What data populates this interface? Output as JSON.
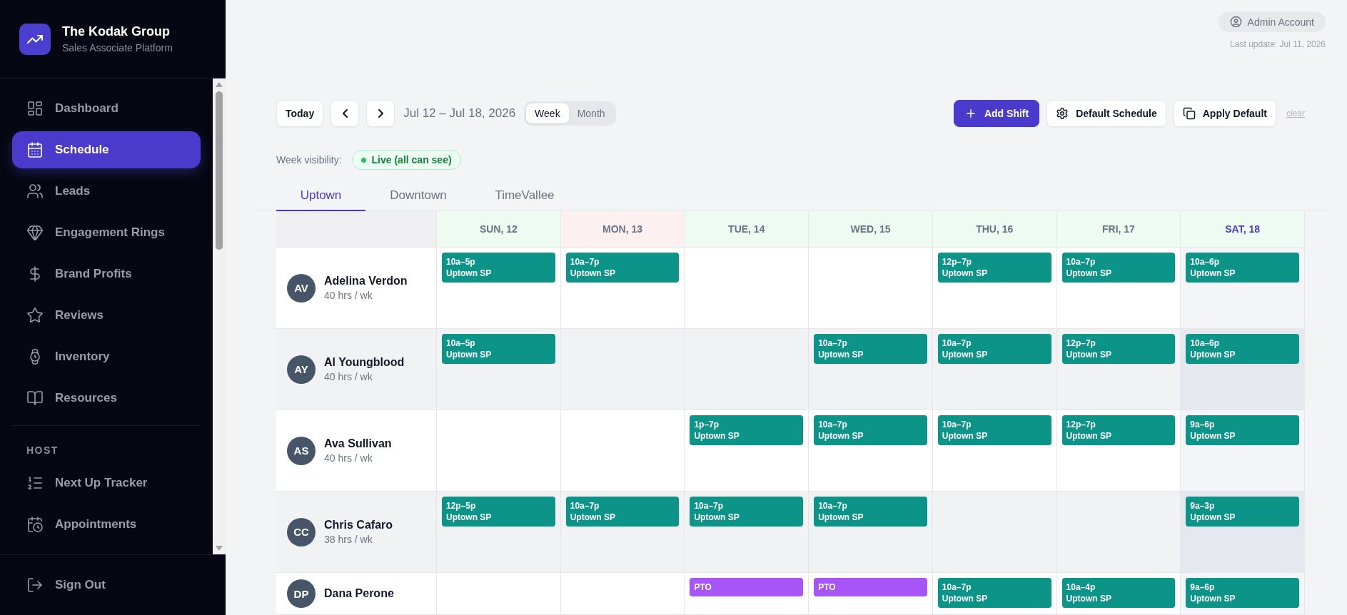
{
  "brand": {
    "title": "The Kodak Group",
    "subtitle": "Sales Associate Platform"
  },
  "sidebar": {
    "items": [
      {
        "label": "Dashboard",
        "selected": false
      },
      {
        "label": "Schedule",
        "selected": true
      },
      {
        "label": "Leads",
        "selected": false
      },
      {
        "label": "Engagement Rings",
        "selected": false
      },
      {
        "label": "Brand Profits",
        "selected": false
      },
      {
        "label": "Reviews",
        "selected": false
      },
      {
        "label": "Inventory",
        "selected": false
      },
      {
        "label": "Resources",
        "selected": false
      }
    ],
    "section": "HOST",
    "host_items": [
      {
        "label": "Next Up Tracker",
        "selected": false
      },
      {
        "label": "Appointments",
        "selected": false
      }
    ],
    "sign_out": "Sign Out"
  },
  "header": {
    "account": "Admin Account",
    "last_update": "Last update: Jul 11, 2026"
  },
  "toolbar": {
    "today": "Today",
    "range": "Jul 12 – Jul 18, 2026",
    "views": [
      {
        "label": "Week",
        "selected": true
      },
      {
        "label": "Month",
        "selected": false
      }
    ],
    "add_shift": "Add Shift",
    "default_schedule": "Default Schedule",
    "apply_default": "Apply Default",
    "clear": "clear"
  },
  "visibility": {
    "label": "Week visibility:",
    "status": "Live (all can see)"
  },
  "location_tabs": [
    {
      "label": "Uptown",
      "selected": true
    },
    {
      "label": "Downtown",
      "selected": false
    },
    {
      "label": "TimeVallee",
      "selected": false
    }
  ],
  "schedule": {
    "days": [
      {
        "label": "SUN, 12",
        "color": "#edfbf2",
        "selected": false
      },
      {
        "label": "MON, 13",
        "color": "#fdf0f0",
        "selected": false
      },
      {
        "label": "TUE, 14",
        "color": "#edfbf2",
        "selected": false
      },
      {
        "label": "WED, 15",
        "color": "#edfbf2",
        "selected": false
      },
      {
        "label": "THU, 16",
        "color": "#edfbf2",
        "selected": false
      },
      {
        "label": "FRI, 17",
        "color": "#edfbf2",
        "selected": false
      },
      {
        "label": "SAT, 18",
        "color": "#edfbf2",
        "selected": true
      }
    ],
    "rows": [
      {
        "initials": "AV",
        "name": "Adelina Verdon",
        "hours": "40 hrs / wk",
        "cells": [
          {
            "kind": "shift",
            "time": "10a–5p",
            "location": "Uptown SP"
          },
          {
            "kind": "shift",
            "time": "10a–7p",
            "location": "Uptown SP"
          },
          null,
          null,
          {
            "kind": "shift",
            "time": "12p–7p",
            "location": "Uptown SP"
          },
          {
            "kind": "shift",
            "time": "10a–7p",
            "location": "Uptown SP"
          },
          {
            "kind": "shift",
            "time": "10a–6p",
            "location": "Uptown SP"
          }
        ]
      },
      {
        "initials": "AY",
        "name": "Al Youngblood",
        "hours": "40 hrs / wk",
        "cells": [
          {
            "kind": "shift",
            "time": "10a–5p",
            "location": "Uptown SP"
          },
          null,
          null,
          {
            "kind": "shift",
            "time": "10a–7p",
            "location": "Uptown SP"
          },
          {
            "kind": "shift",
            "time": "10a–7p",
            "location": "Uptown SP"
          },
          {
            "kind": "shift",
            "time": "12p–7p",
            "location": "Uptown SP"
          },
          {
            "kind": "shift",
            "time": "10a–6p",
            "location": "Uptown SP"
          }
        ]
      },
      {
        "initials": "AS",
        "name": "Ava Sullivan",
        "hours": "40 hrs / wk",
        "cells": [
          null,
          null,
          {
            "kind": "shift",
            "time": "1p–7p",
            "location": "Uptown SP"
          },
          {
            "kind": "shift",
            "time": "10a–7p",
            "location": "Uptown SP"
          },
          {
            "kind": "shift",
            "time": "10a–7p",
            "location": "Uptown SP"
          },
          {
            "kind": "shift",
            "time": "12p–7p",
            "location": "Uptown SP"
          },
          {
            "kind": "shift",
            "time": "9a–6p",
            "location": "Uptown SP"
          }
        ]
      },
      {
        "initials": "CC",
        "name": "Chris Cafaro",
        "hours": "38 hrs / wk",
        "cells": [
          {
            "kind": "shift",
            "time": "12p–5p",
            "location": "Uptown SP"
          },
          {
            "kind": "shift",
            "time": "10a–7p",
            "location": "Uptown SP"
          },
          {
            "kind": "shift",
            "time": "10a–7p",
            "location": "Uptown SP"
          },
          {
            "kind": "shift",
            "time": "10a–7p",
            "location": "Uptown SP"
          },
          null,
          null,
          {
            "kind": "shift",
            "time": "9a–3p",
            "location": "Uptown SP"
          }
        ]
      },
      {
        "initials": "DP",
        "name": "Dana Perone",
        "cells": [
          null,
          null,
          {
            "kind": "pto",
            "time": "PTO"
          },
          {
            "kind": "pto",
            "time": "PTO"
          },
          {
            "kind": "shift",
            "time": "10a–7p",
            "location": "Uptown SP"
          },
          {
            "kind": "shift",
            "time": "10a–4p",
            "location": "Uptown SP"
          },
          {
            "kind": "shift",
            "time": "9a–6p",
            "location": "Uptown SP"
          }
        ]
      }
    ]
  }
}
